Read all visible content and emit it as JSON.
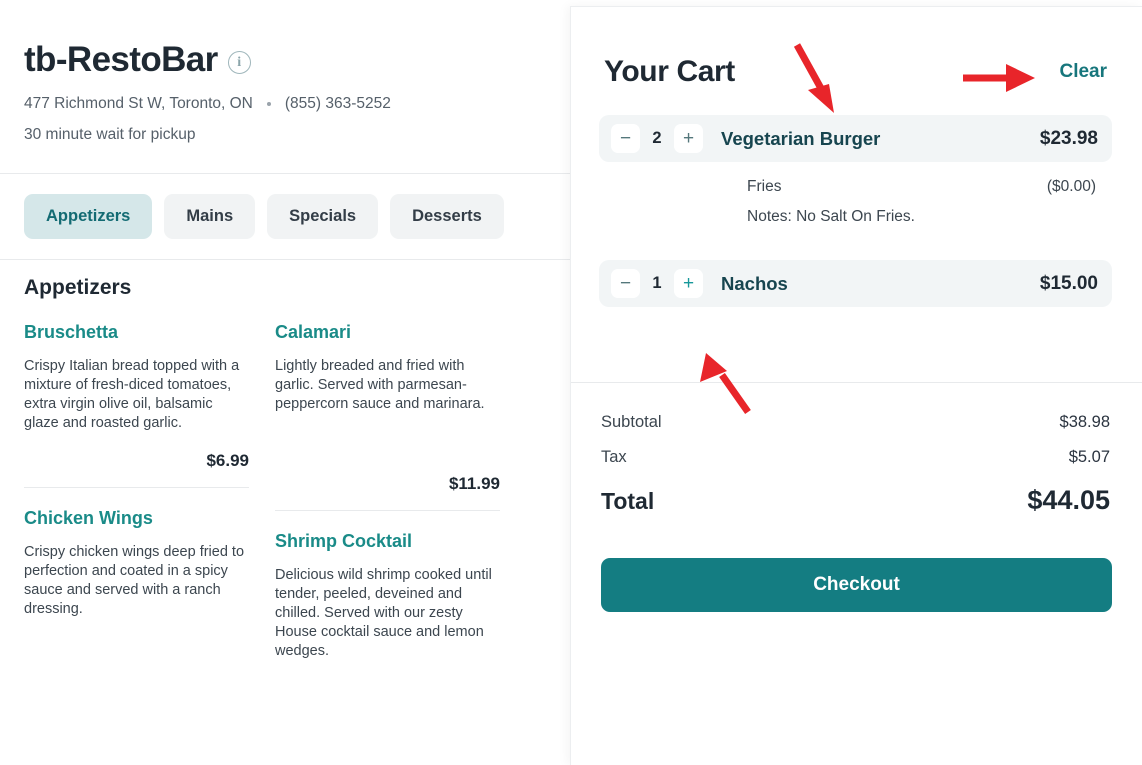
{
  "restaurant": {
    "name": "tb-RestoBar",
    "info_icon": "info-circle-icon",
    "address": "477 Richmond St W, Toronto, ON",
    "phone": "(855) 363-5252",
    "wait": "30 minute wait for pickup"
  },
  "tabs": [
    {
      "label": "Appetizers",
      "active": true
    },
    {
      "label": "Mains",
      "active": false
    },
    {
      "label": "Specials",
      "active": false
    },
    {
      "label": "Desserts",
      "active": false
    }
  ],
  "menu": {
    "section_title": "Appetizers",
    "items": [
      {
        "name": "Bruschetta",
        "desc": "Crispy Italian bread topped with a mixture of fresh-diced tomatoes, extra virgin olive oil, balsamic glaze and roasted garlic.",
        "price": "$6.99"
      },
      {
        "name": "Calamari",
        "desc": "Lightly breaded and fried with garlic. Served with parmesan-peppercorn sauce and marinara.",
        "price": "$11.99"
      },
      {
        "name": "Chicken Wings",
        "desc": "Crispy chicken wings deep fried to perfection and coated in a spicy sauce and served with a ranch dressing.",
        "price": ""
      },
      {
        "name": "Shrimp Cocktail",
        "desc": "Delicious wild shrimp cooked until tender, peeled, deveined and chilled. Served with our zesty House cocktail sauce and lemon wedges.",
        "price": ""
      }
    ]
  },
  "cart": {
    "title": "Your Cart",
    "clear_label": "Clear",
    "minus_label": "−",
    "plus_label": "+",
    "items": [
      {
        "qty": "2",
        "name": "Vegetarian Burger",
        "price": "$23.98",
        "option_label": "Fries",
        "option_price": "($0.00)",
        "notes": "Notes: No Salt On Fries."
      },
      {
        "qty": "1",
        "name": "Nachos",
        "price": "$15.00"
      }
    ],
    "subtotal_label": "Subtotal",
    "subtotal_value": "$38.98",
    "tax_label": "Tax",
    "tax_value": "$5.07",
    "total_label": "Total",
    "total_value": "$44.05",
    "checkout_label": "Checkout"
  },
  "colors": {
    "teal": "#147d82",
    "teal_link": "#17767c",
    "item_teal": "#1a8b88",
    "cart_name": "#17454f",
    "tab_active_bg": "#d5e7e9",
    "annotation_red": "#e8252a"
  }
}
